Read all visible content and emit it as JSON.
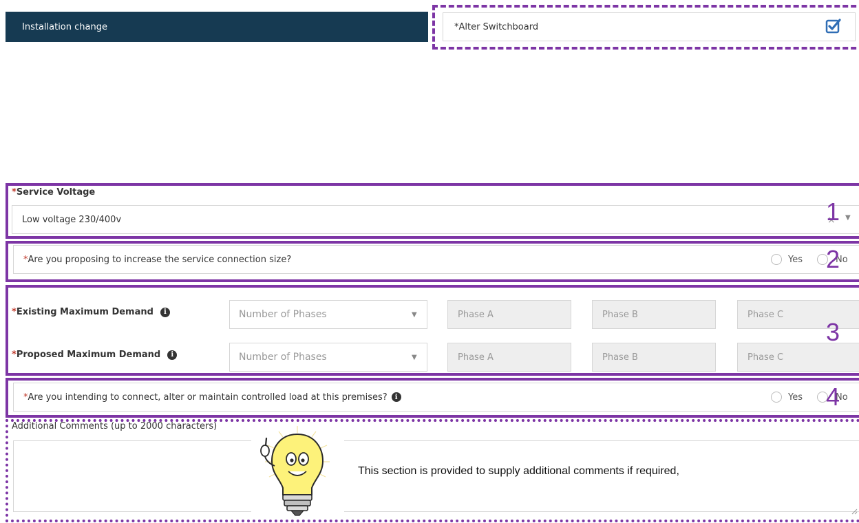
{
  "header": {
    "title": "Installation change",
    "alter_label": "Alter Switchboard",
    "alter_checked": true
  },
  "required_mark": "*",
  "service_voltage": {
    "label": "Service Voltage",
    "value": "Low voltage 230/400v",
    "clear_glyph": "×"
  },
  "q_service_size": {
    "label": "Are you proposing to increase the service connection size?",
    "options": [
      "Yes",
      "No"
    ]
  },
  "demand": {
    "existing_label": "Existing Maximum Demand",
    "proposed_label": "Proposed Maximum Demand",
    "phases_placeholder": "Number of Phases",
    "phase_a": "Phase A",
    "phase_b": "Phase B",
    "phase_c": "Phase C"
  },
  "q_controlled_load": {
    "label": "Are you intending to connect, alter or maintain controlled load at this premises?",
    "options": [
      "Yes",
      "No"
    ]
  },
  "comments": {
    "label": "Additional Comments (up to 2000 characters)",
    "hint": "This section is provided to supply additional comments if required,"
  },
  "annotations": {
    "n1": "1",
    "n2": "2",
    "n3": "3",
    "n4": "4"
  },
  "colors": {
    "accent": "#7d35a5",
    "header_bg": "#163a52",
    "required": "#c0392b",
    "checkbox": "#2f6db5"
  },
  "icons": [
    "checkbox-checked-icon",
    "clear-icon",
    "chevron-down-icon",
    "info-icon",
    "lightbulb-mascot-icon",
    "resize-grip-icon"
  ]
}
